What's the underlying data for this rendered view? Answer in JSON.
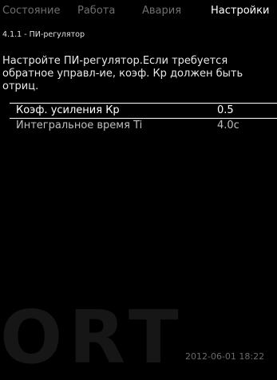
{
  "tabs": [
    {
      "label": "Состояние",
      "active": false
    },
    {
      "label": "Работа",
      "active": false
    },
    {
      "label": "Авария",
      "active": false
    },
    {
      "label": "Настройки",
      "active": true
    }
  ],
  "breadcrumb": "4.1.1 - ПИ-регулятор",
  "description": "Настройте ПИ-регулятор.Если требуется обратное управл-ие, коэф. Кр должен быть отриц.",
  "params": [
    {
      "label": "Коэф. усиления Кр",
      "value": "0.5",
      "selected": true
    },
    {
      "label": "Интегральное время Ti",
      "value": "4.0с",
      "selected": false
    }
  ],
  "watermark": "ORT",
  "timestamp": "2012-06-01 18:22"
}
